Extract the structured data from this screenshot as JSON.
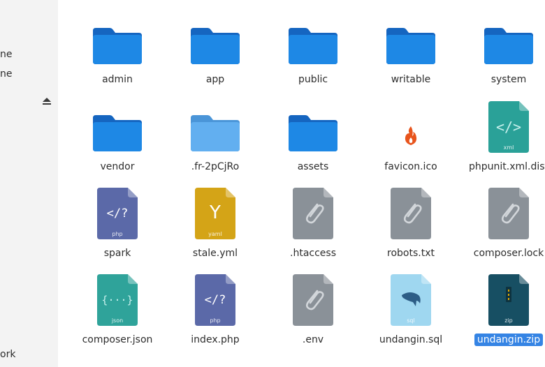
{
  "sidebar": {
    "items": [
      {
        "label": "ne"
      },
      {
        "label": "ne"
      },
      {
        "label": "ork"
      }
    ]
  },
  "files": [
    {
      "name": "admin",
      "type": "folder"
    },
    {
      "name": "app",
      "type": "folder"
    },
    {
      "name": "public",
      "type": "folder"
    },
    {
      "name": "writable",
      "type": "folder"
    },
    {
      "name": "system",
      "type": "folder"
    },
    {
      "name": "vendor",
      "type": "folder"
    },
    {
      "name": ".fr-2pCjRo",
      "type": "folder-light"
    },
    {
      "name": "assets",
      "type": "folder"
    },
    {
      "name": "favicon.ico",
      "type": "codeigniter"
    },
    {
      "name": "phpunit.xml.dist",
      "type": "xml",
      "badge": "xml"
    },
    {
      "name": "spark",
      "type": "php",
      "badge": "php"
    },
    {
      "name": "stale.yml",
      "type": "yaml",
      "badge": "yaml"
    },
    {
      "name": ".htaccess",
      "type": "generic"
    },
    {
      "name": "robots.txt",
      "type": "generic"
    },
    {
      "name": "composer.lock",
      "type": "generic"
    },
    {
      "name": "composer.json",
      "type": "json",
      "badge": "json"
    },
    {
      "name": "index.php",
      "type": "php",
      "badge": "php"
    },
    {
      "name": ".env",
      "type": "generic"
    },
    {
      "name": "undangin.sql",
      "type": "sql",
      "badge": "sql"
    },
    {
      "name": "undangin.zip",
      "type": "zip",
      "badge": "zip",
      "selected": true
    }
  ],
  "colors": {
    "folder": "#1e88e5",
    "folder_light": "#62aff0",
    "selection": "#3584e4"
  }
}
